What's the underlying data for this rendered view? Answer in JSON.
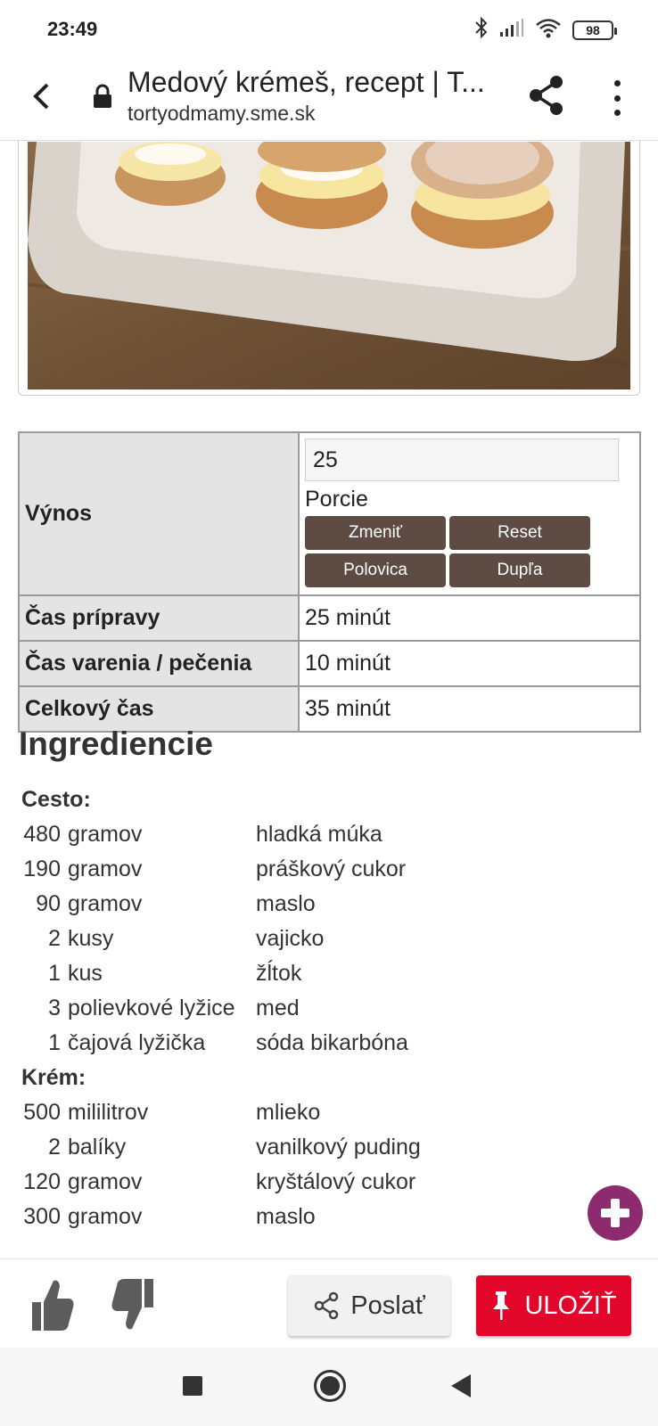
{
  "status_bar": {
    "time": "23:49",
    "battery": "98",
    "icons": [
      "bluetooth-icon",
      "signal-icon",
      "wifi-icon",
      "battery-icon"
    ]
  },
  "browser": {
    "title": "Medový krémeš, recept | T...",
    "url": "tortyodmamy.sme.sk"
  },
  "yield_table": {
    "yield_label": "Výnos",
    "yield_value": "25",
    "yield_unit": "Porcie",
    "buttons": {
      "change": "Zmeniť",
      "reset": "Reset",
      "half": "Polovica",
      "double": "Dupľa"
    },
    "rows": [
      {
        "label": "Čas prípravy",
        "value": "25 minút"
      },
      {
        "label": "Čas varenia / pečenia",
        "value": "10 minút"
      },
      {
        "label": "Celkový čas",
        "value": "35 minút"
      }
    ]
  },
  "ingredients": {
    "title": "Ingrediencie",
    "sections": [
      {
        "name": "Cesto:",
        "items": [
          {
            "amount": "480",
            "unit": "gramov",
            "name": "hladká múka"
          },
          {
            "amount": "190",
            "unit": "gramov",
            "name": "práškový cukor"
          },
          {
            "amount": "90",
            "unit": "gramov",
            "name": "maslo"
          },
          {
            "amount": "2",
            "unit": "kusy",
            "name": "vajicko"
          },
          {
            "amount": "1",
            "unit": "kus",
            "name": "žĺtok"
          },
          {
            "amount": "3",
            "unit": "polievkové lyžice",
            "name": "med"
          },
          {
            "amount": "1",
            "unit": "čajová lyžička",
            "name": "sóda bikarbóna"
          }
        ]
      },
      {
        "name": "Krém:",
        "items": [
          {
            "amount": "500",
            "unit": "mililitrov",
            "name": "mlieko"
          },
          {
            "amount": "2",
            "unit": "balíky",
            "name": "vanilkový puding"
          },
          {
            "amount": "120",
            "unit": "gramov",
            "name": "kryštálový cukor"
          },
          {
            "amount": "300",
            "unit": "gramov",
            "name": "maslo"
          }
        ]
      }
    ]
  },
  "actions": {
    "send_label": "Poslať",
    "save_label": "ULOŽIŤ"
  },
  "colors": {
    "brown_button": "#5e4b43",
    "save_red": "#e2062b",
    "fab_purple": "#8e2a6e",
    "table_label_bg": "#e4e4e4"
  }
}
